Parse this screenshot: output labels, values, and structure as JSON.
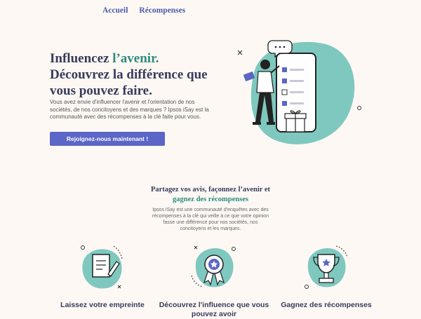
{
  "nav": {
    "items": [
      "Accueil",
      "Récompenses"
    ]
  },
  "hero": {
    "title_part1": "Influencez ",
    "title_accent": "l’avenir.",
    "title_part2": "Découvrez la différence que vous pouvez faire.",
    "description": "Vous avez envie d'influencer l'avenir et l'orientation de nos sociétés, de nos concitoyens et des marques ? Ipsos iSay est la communauté avec des récompenses à la clé faite pour vous.",
    "cta_label": "Rejoignez-nous maintenant !"
  },
  "section": {
    "title_part1": "Partagez vos avis, façonnez l’avenir et",
    "title_accent": "gagnez des récompenses",
    "description": "Ipsos iSay est une communauté d'enquêtes avec des récompenses à la clé qui veille à ce que votre opinion fasse une différence pour nos sociétés, nos concitoyens et les marques."
  },
  "features": [
    {
      "title": "Laissez votre empreinte",
      "icon": "pen-paper-icon"
    },
    {
      "title": "Découvrez l'influence que vous pouvez avoir",
      "icon": "award-badge-icon"
    },
    {
      "title": "Gagnez des récompenses",
      "icon": "trophy-icon"
    }
  ],
  "colors": {
    "accent": "#2e8b7e",
    "blob": "#7ec8bf",
    "button": "#5b66c6",
    "title": "#383b5c",
    "nav": "#4a5aa8"
  }
}
